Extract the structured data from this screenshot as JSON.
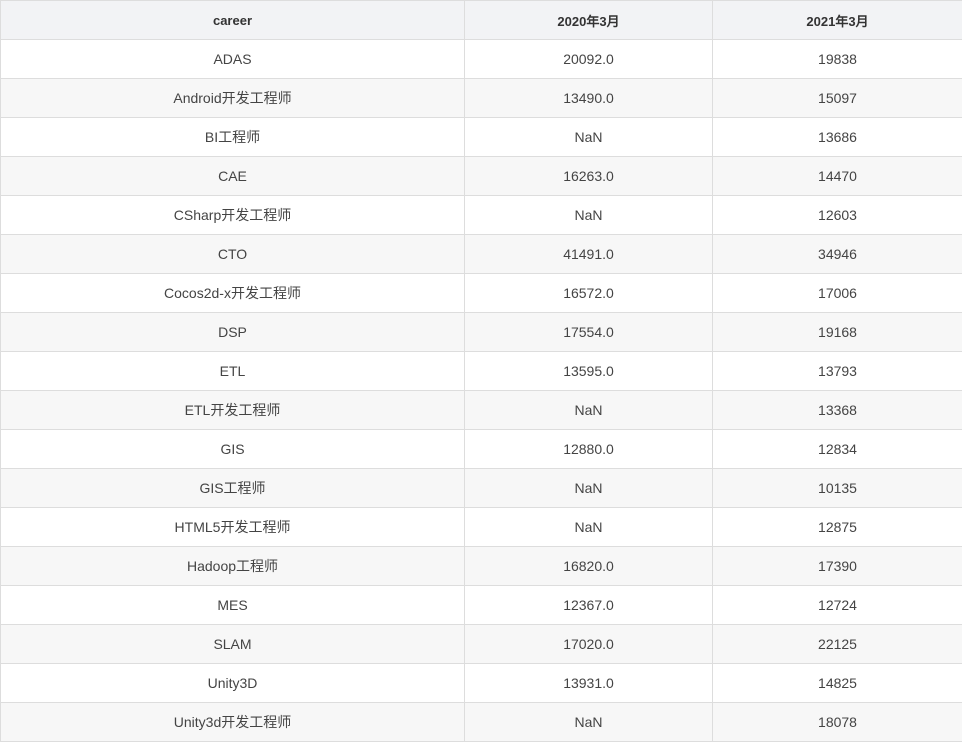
{
  "table": {
    "columns": [
      "career",
      "2020年3月",
      "2021年3月"
    ],
    "rows": [
      [
        "ADAS",
        "20092.0",
        "19838"
      ],
      [
        "Android开发工程师",
        "13490.0",
        "15097"
      ],
      [
        "BI工程师",
        "NaN",
        "13686"
      ],
      [
        "CAE",
        "16263.0",
        "14470"
      ],
      [
        "CSharp开发工程师",
        "NaN",
        "12603"
      ],
      [
        "CTO",
        "41491.0",
        "34946"
      ],
      [
        "Cocos2d-x开发工程师",
        "16572.0",
        "17006"
      ],
      [
        "DSP",
        "17554.0",
        "19168"
      ],
      [
        "ETL",
        "13595.0",
        "13793"
      ],
      [
        "ETL开发工程师",
        "NaN",
        "13368"
      ],
      [
        "GIS",
        "12880.0",
        "12834"
      ],
      [
        "GIS工程师",
        "NaN",
        "10135"
      ],
      [
        "HTML5开发工程师",
        "NaN",
        "12875"
      ],
      [
        "Hadoop工程师",
        "16820.0",
        "17390"
      ],
      [
        "MES",
        "12367.0",
        "12724"
      ],
      [
        "SLAM",
        "17020.0",
        "22125"
      ],
      [
        "Unity3D",
        "13931.0",
        "14825"
      ],
      [
        "Unity3d开发工程师",
        "NaN",
        "18078"
      ]
    ]
  },
  "colors": {
    "header_bg": "#f2f3f5",
    "row_alt_bg": "#f7f7f7",
    "border": "#dddddd",
    "text": "#444444"
  }
}
